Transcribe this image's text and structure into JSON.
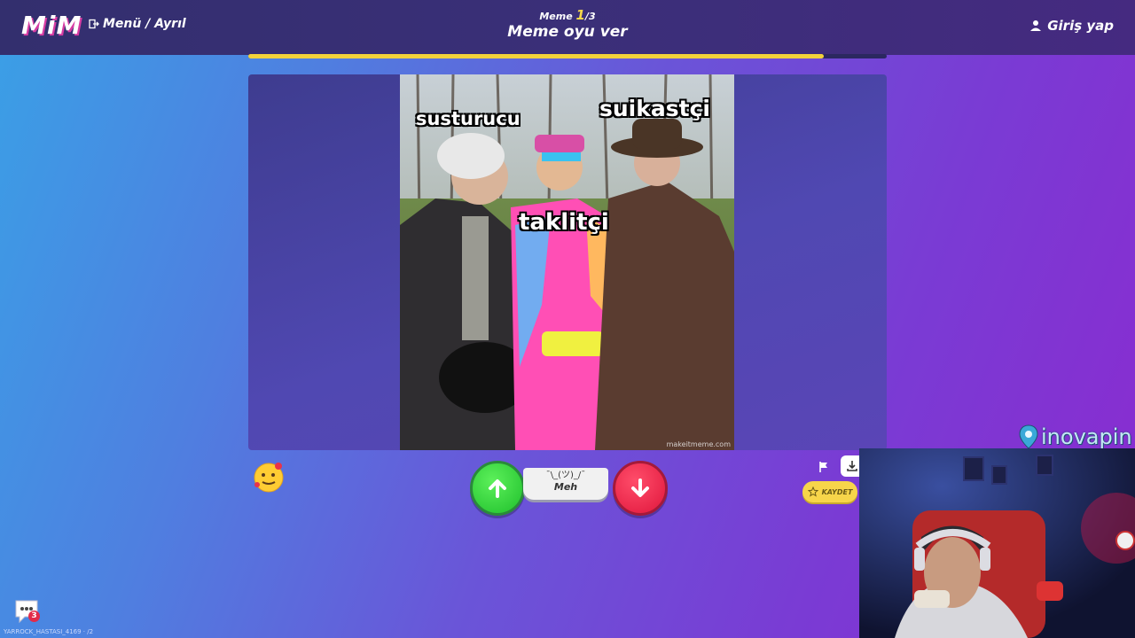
{
  "header": {
    "logo": "MiM",
    "menu_label": "Menü / Ayrıl",
    "round_prefix": "Meme ",
    "round_current": "1",
    "round_total": "/3",
    "mode_title": "Meme oyu ver",
    "login_label": "Giriş yap",
    "progress": 0.902
  },
  "meme": {
    "captions": [
      "susturucu",
      "suikastçi",
      "taklitçi"
    ],
    "watermark": "makeitmeme.com"
  },
  "controls": {
    "meh_shrug": "¯\\_(ツ)_/¯",
    "meh_label": "Meh",
    "save_label": "KAYDET"
  },
  "chat": {
    "unread_count": "3",
    "player_tag": "YARROCK_HASTASI_4169 · /2"
  },
  "sponsor": {
    "name": "inovapin"
  },
  "colors": {
    "accent_yellow": "#f3d23a",
    "upvote_green": "#1fbf2c",
    "downvote_red": "#e0163c",
    "header_bg": "#352f70"
  }
}
